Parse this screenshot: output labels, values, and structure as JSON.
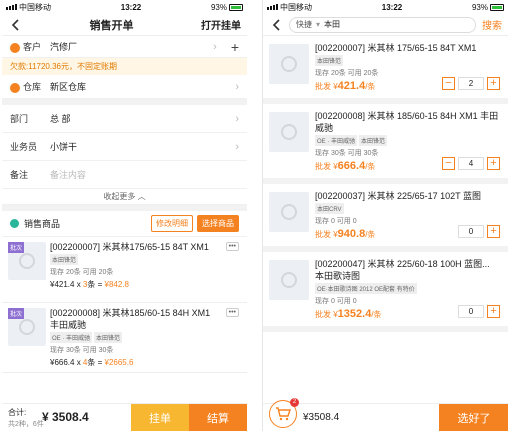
{
  "left": {
    "status": {
      "carrier": "中国移动",
      "time": "13:22",
      "battery": "93%"
    },
    "nav": {
      "title": "销售开单",
      "right": "打开挂单"
    },
    "customer": {
      "label": "客户",
      "value": "汽修厂"
    },
    "debt": "欠款:11720.36元，不固定账期",
    "warehouse": {
      "label": "仓库",
      "value": "新区仓库"
    },
    "department": {
      "label": "部门",
      "value": "总 部"
    },
    "salesman": {
      "label": "业务员",
      "value": "小饼干"
    },
    "remark": {
      "label": "备注",
      "placeholder": "备注内容"
    },
    "collapse": "收起更多",
    "section": {
      "title": "销售商品",
      "edit_btn": "修改明细",
      "select_btn": "选择商品"
    },
    "items": [
      {
        "tag": "批次",
        "name": "[002200007] 米其林175/65-15 84T XM1",
        "badges": [
          "本田锋范"
        ],
        "stock": "现存 20条  可用 20条",
        "price": "¥421.4",
        "qty": "3",
        "unit": "条",
        "total": "¥842.8"
      },
      {
        "tag": "批次",
        "name": "[002200008] 米其林185/60-15 84H XM1 丰田威驰",
        "badges": [
          "OE · 丰田威驰",
          "本田锋范"
        ],
        "stock": "现存 30条  可用 30条",
        "price": "¥666.4",
        "qty": "4",
        "unit": "条",
        "total": "¥2665.6"
      }
    ],
    "bottom": {
      "sum_label": "合计:",
      "amount": "¥ 3508.4",
      "sub": "共2种，6件",
      "hang": "挂单",
      "settle": "结算"
    }
  },
  "right": {
    "status": {
      "carrier": "中国移动",
      "time": "13:22",
      "battery": "93%"
    },
    "search": {
      "prefix": "快捷",
      "value": "本田",
      "btn": "搜索"
    },
    "items": [
      {
        "name": "[002200007] 米其林 175/65-15 84T XM1",
        "badges": [
          "本田锋范"
        ],
        "stock": "现存 20条  可用 20条",
        "wprice_label": "批发 ¥",
        "wprice": "421.4",
        "unit": "/条",
        "qty": "2"
      },
      {
        "name": "[002200008] 米其林 185/60-15 84H XM1 丰田威驰",
        "badges": [
          "OE · 丰田威驰",
          "本田锋范"
        ],
        "stock": "现存 30条  可用 30条",
        "wprice_label": "批发 ¥",
        "wprice": "666.4",
        "unit": "/条",
        "qty": "4"
      },
      {
        "name": "[002200037] 米其林 225/65-17 102T 蓝图",
        "badges": [
          "本田CRV"
        ],
        "stock": "现存 0  可用 0",
        "wprice_label": "批发 ¥",
        "wprice": "940.8",
        "unit": "/条",
        "qty": "0"
      },
      {
        "name": "[002200047] 米其林 225/60-18 100H 蓝图... 本田歌诗图",
        "badges": [
          "OE·本田歌诗图 2012 OE配套 有特价"
        ],
        "stock": "现存 0  可用 0",
        "wprice_label": "批发 ¥",
        "wprice": "1352.4",
        "unit": "/条",
        "qty": "0"
      }
    ],
    "bottom": {
      "count": "2",
      "total": "¥3508.4",
      "go": "选好了"
    }
  },
  "colors": {
    "accent": "#f58220",
    "hang": "#f7b731",
    "teal": "#29b59a"
  }
}
